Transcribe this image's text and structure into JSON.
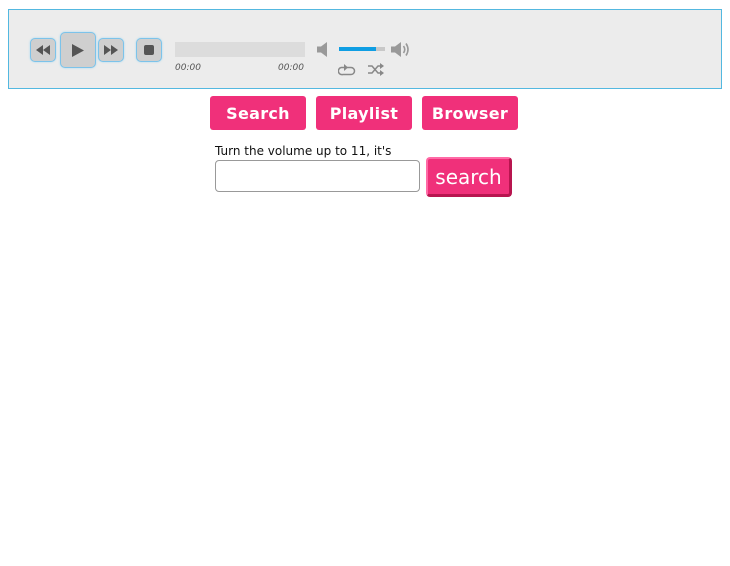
{
  "player": {
    "current_time": "00:00",
    "total_time": "00:00",
    "volume_percent": 80,
    "controls": [
      "rewind-icon",
      "play-icon",
      "fast-forward-icon",
      "stop-icon",
      "mute-icon",
      "volume-max-icon",
      "repeat-icon",
      "shuffle-icon"
    ]
  },
  "nav": {
    "search_label": "Search",
    "playlist_label": "Playlist",
    "browser_label": "Browser"
  },
  "search": {
    "prompt": "Turn the volume up to 11, it's",
    "value": "",
    "button_label": "search"
  },
  "colors": {
    "accent": "#f0307a",
    "player_border": "#53b8e0",
    "volume_fill": "#0f9ee3"
  }
}
